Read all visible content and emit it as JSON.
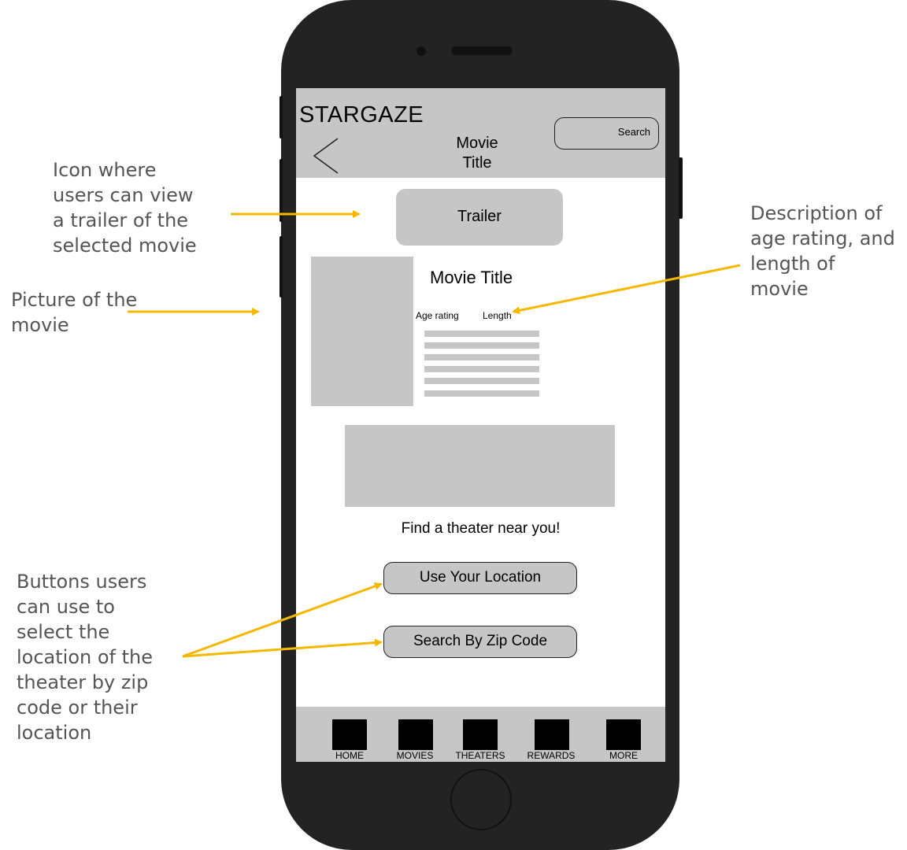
{
  "app": {
    "brand": "STARGAZE",
    "header_title": "Movie\nTitle",
    "search_label": "Search"
  },
  "main": {
    "trailer_label": "Trailer",
    "movie_title": "Movie Title",
    "age_rating_label": "Age rating",
    "length_label": "Length",
    "find_theater_text": "Find a theater near you!",
    "use_location_label": "Use Your Location",
    "zip_code_label": "Search By Zip Code"
  },
  "bottom_nav": {
    "items": [
      {
        "label": "HOME"
      },
      {
        "label": "MOVIES"
      },
      {
        "label": "THEATERS"
      },
      {
        "label": "REWARDS"
      },
      {
        "label": "MORE"
      }
    ]
  },
  "annotations": {
    "trailer_note": "Icon where\nusers can view\na trailer of the\nselected movie",
    "picture_note": "Picture of the\nmovie",
    "description_note": "Description of\nage rating, and\nlength of\nmovie",
    "buttons_note": "Buttons users\ncan use to\nselect the\nlocation of the\ntheater by zip\ncode or their\nlocation"
  },
  "colors": {
    "arrow": "#f5b800",
    "placeholder_gray": "#c6c6c6",
    "phone_body": "#232323"
  }
}
